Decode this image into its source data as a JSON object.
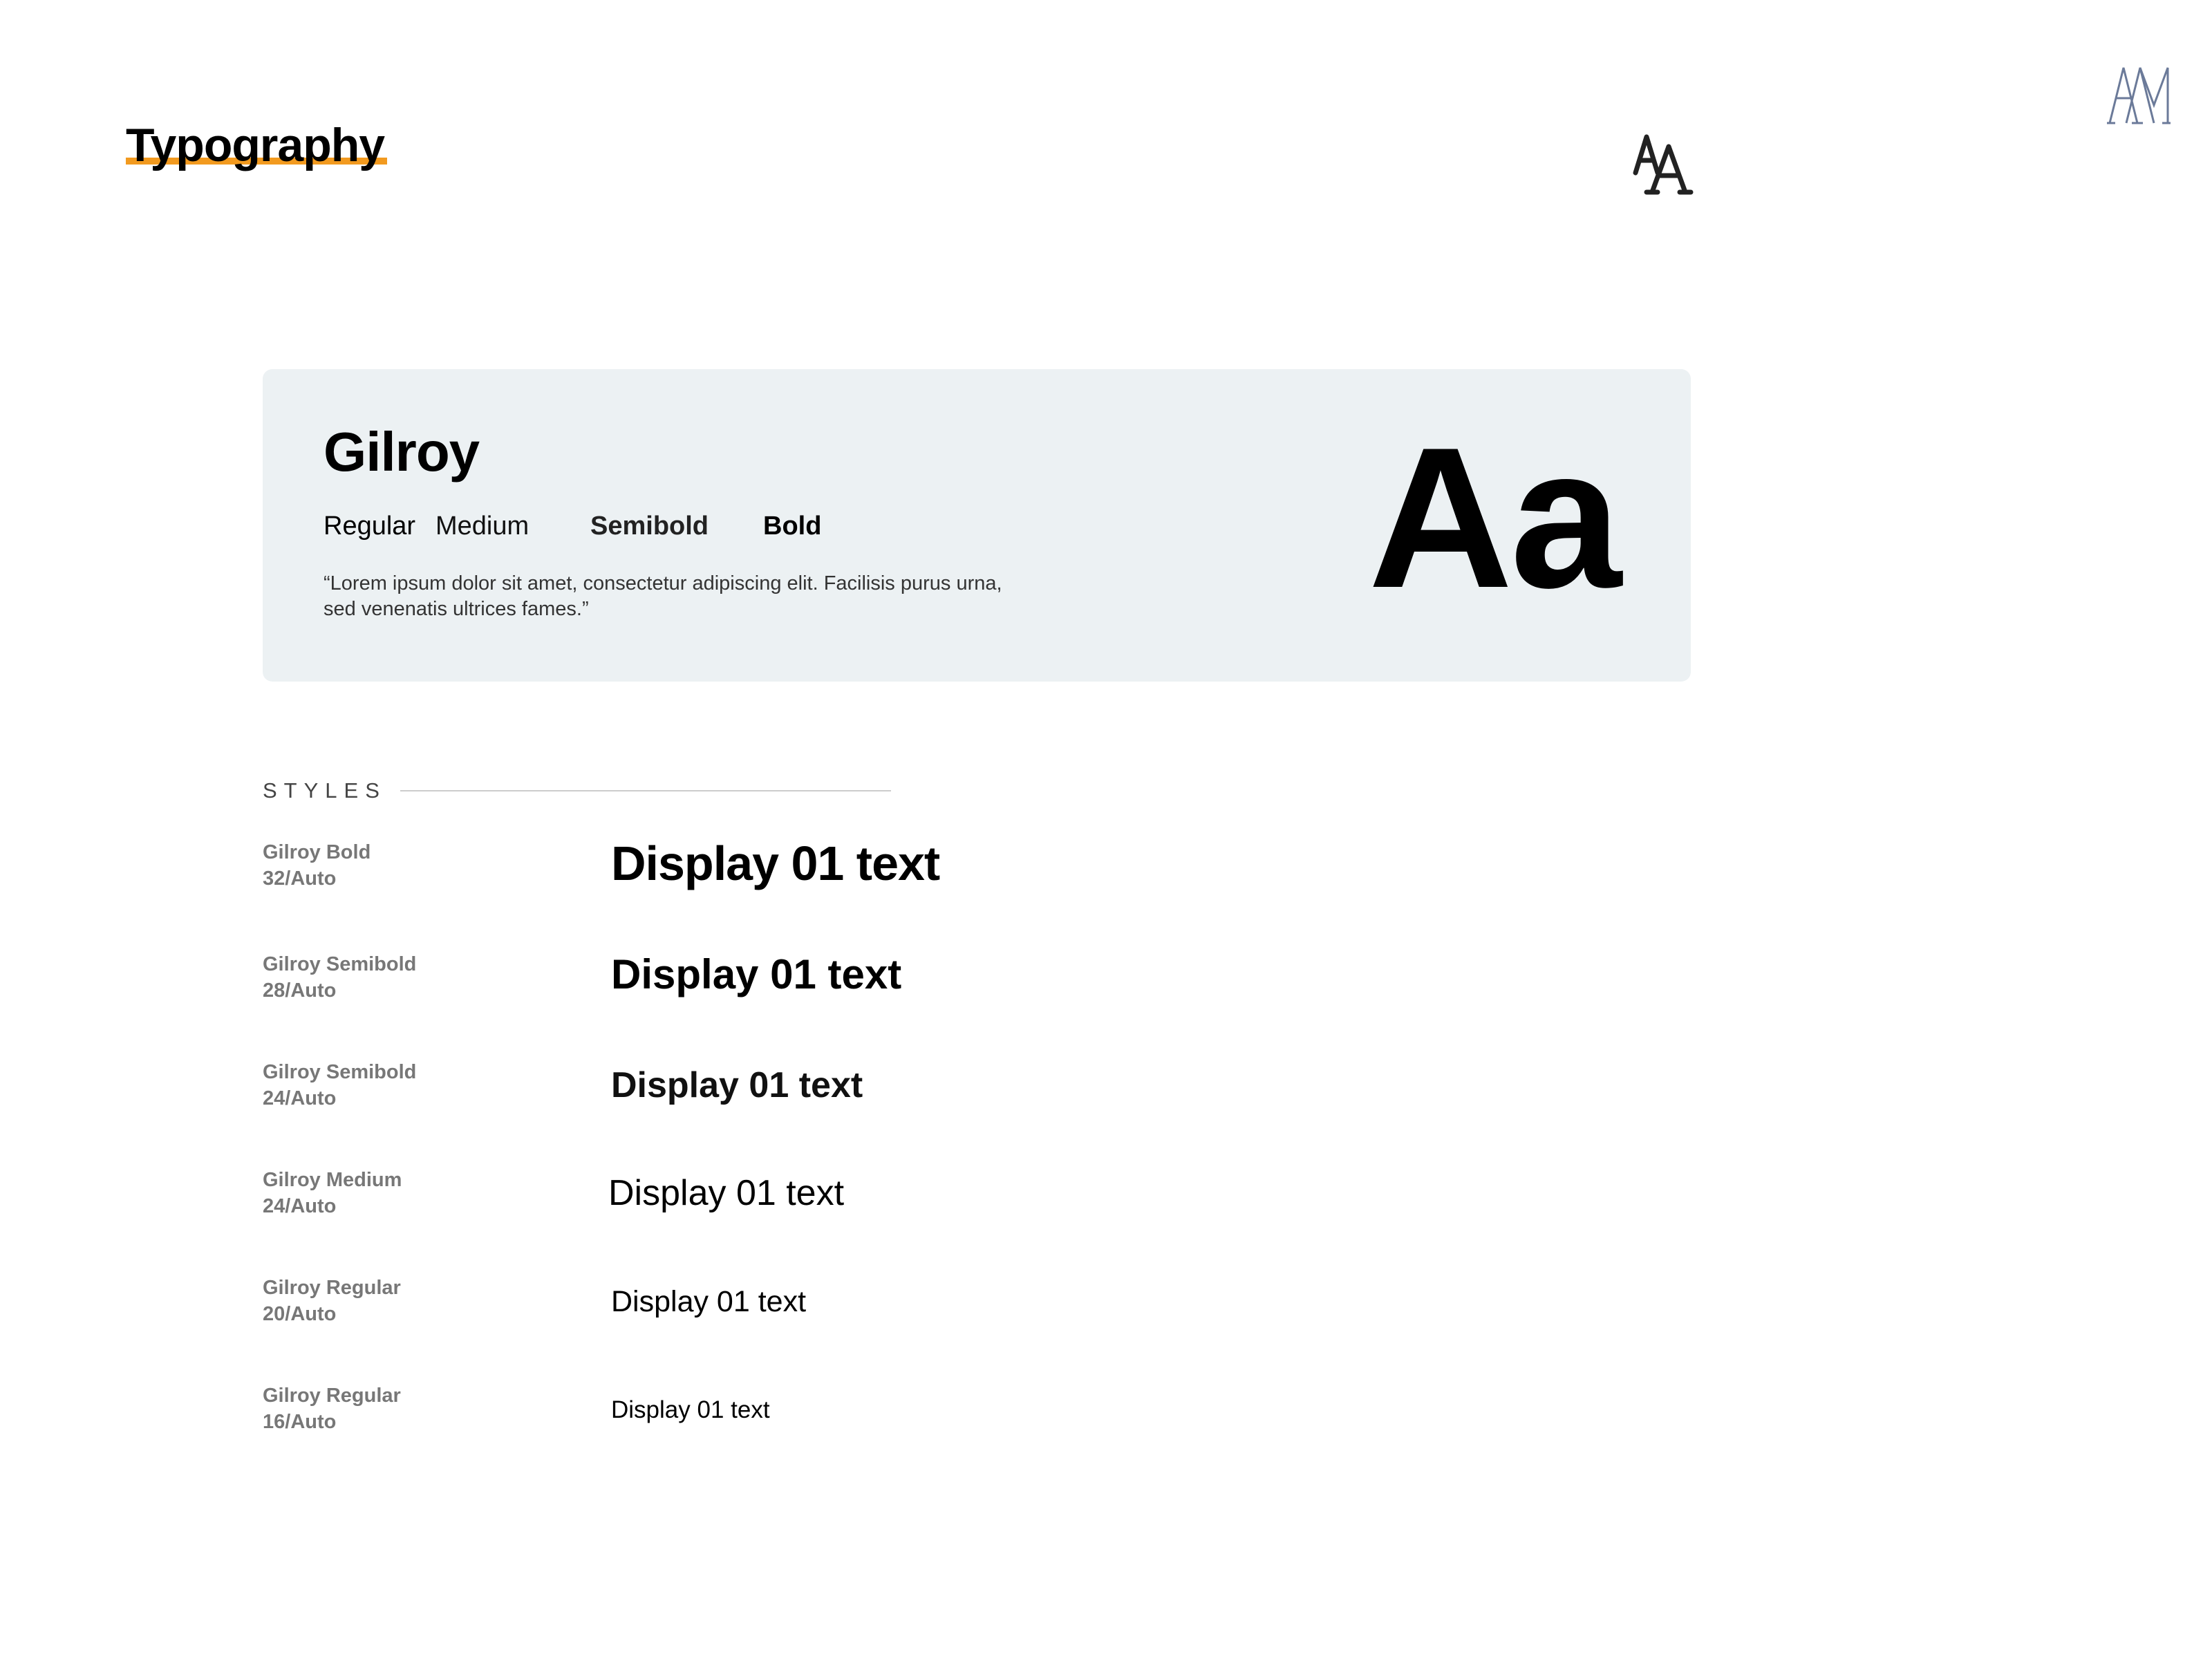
{
  "header": {
    "title": "Typography"
  },
  "colors": {
    "accent": "#f29a1f",
    "card_background": "#ecf1f3",
    "logo": "#6b7a99"
  },
  "icons": {
    "brand_logo": "monogram-logo-icon",
    "font_size": "text-size-aa-icon"
  },
  "font_card": {
    "name": "Gilroy",
    "weights": [
      "Regular",
      "Medium",
      "Semibold",
      "Bold"
    ],
    "sample": "“Lorem ipsum dolor sit amet, consectetur adipiscing elit. Facilisis purus urna, sed venenatis ultrices fames.”",
    "specimen": "Aa"
  },
  "styles": {
    "label": "STYLES",
    "items": [
      {
        "font": "Gilroy Bold",
        "size": "32/Auto",
        "sample": "Display 01 text"
      },
      {
        "font": "Gilroy Semibold",
        "size": "28/Auto",
        "sample": "Display 01 text"
      },
      {
        "font": "Gilroy Semibold",
        "size": "24/Auto",
        "sample": "Display 01 text"
      },
      {
        "font": "Gilroy Medium",
        "size": "24/Auto",
        "sample": "Display 01 text"
      },
      {
        "font": "Gilroy Regular",
        "size": "20/Auto",
        "sample": "Display 01 text"
      },
      {
        "font": "Gilroy Regular",
        "size": "16/Auto",
        "sample": "Display 01 text"
      }
    ]
  }
}
